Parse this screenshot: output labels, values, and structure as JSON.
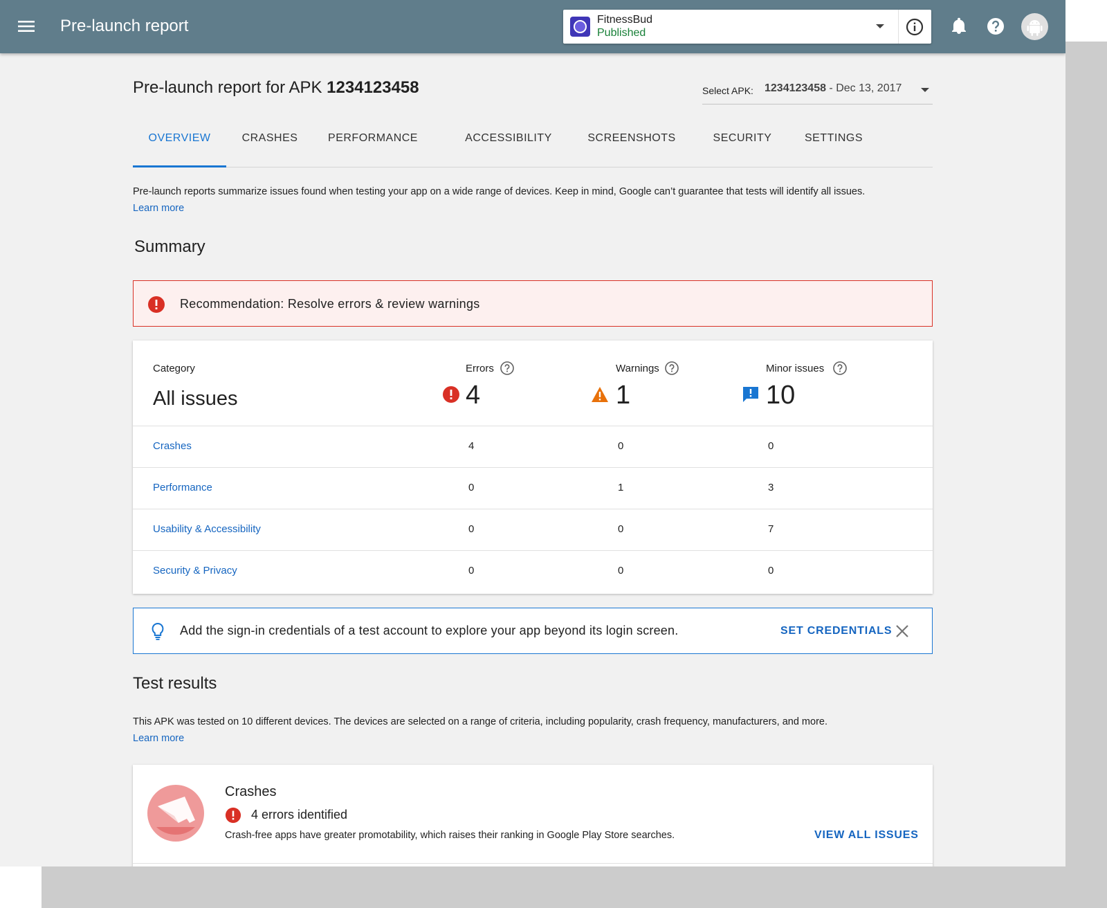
{
  "appbar": {
    "title": "Pre-launch report",
    "app_name": "FitnessBud",
    "app_status": "Published",
    "icons": [
      "menu-icon",
      "chevron-down-icon",
      "info-icon",
      "bell-icon",
      "help-icon",
      "android-avatar-icon"
    ]
  },
  "page": {
    "title_prefix": "Pre-launch report for APK ",
    "title_apk": "1234123458",
    "apk_select_label": "Select APK:",
    "apk_select_number": "1234123458",
    "apk_select_date": " - Dec 13, 2017"
  },
  "tabs": [
    {
      "label": "OVERVIEW",
      "active": true
    },
    {
      "label": "CRASHES"
    },
    {
      "label": "PERFORMANCE"
    },
    {
      "label": "ACCESSIBILITY"
    },
    {
      "label": "SCREENSHOTS"
    },
    {
      "label": "SECURITY"
    },
    {
      "label": "SETTINGS"
    }
  ],
  "intro": {
    "text": "Pre-launch reports summarize issues found when testing your app on a wide range of devices. Keep in mind, Google can’t guarantee that tests will identify all issues.",
    "learn_more": "Learn more"
  },
  "summary": {
    "title": "Summary",
    "recommendation": "Recommendation: Resolve errors & review warnings",
    "header": {
      "category_label": "Category",
      "category_value": "All issues",
      "errors_label": "Errors",
      "errors_value": "4",
      "warnings_label": "Warnings",
      "warnings_value": "1",
      "minor_label": "Minor issues",
      "minor_value": "10"
    },
    "rows": [
      {
        "category": "Crashes",
        "errors": "4",
        "warnings": "0",
        "minor": "0"
      },
      {
        "category": "Performance",
        "errors": "0",
        "warnings": "1",
        "minor": "3"
      },
      {
        "category": "Usability & Accessibility",
        "errors": "0",
        "warnings": "0",
        "minor": "7"
      },
      {
        "category": "Security & Privacy",
        "errors": "0",
        "warnings": "0",
        "minor": "0"
      }
    ]
  },
  "credentials": {
    "text": "Add the sign-in credentials of a test account to explore your app beyond its login screen.",
    "button": "SET CREDENTIALS"
  },
  "test_results": {
    "title": "Test results",
    "text": "This APK was tested on 10 different devices. The devices are selected on a range of criteria, including popularity, crash frequency, manufacturers, and more.",
    "learn_more": "Learn more",
    "crashes_card": {
      "title": "Crashes",
      "errors": "4 errors identified",
      "description": "Crash-free apps have greater promotability, which raises their ranking in Google Play Store searches.",
      "button": "VIEW ALL ISSUES"
    }
  },
  "colors": {
    "appbar": "#607d8b",
    "accent": "#1976d2",
    "error": "#d93025",
    "warning": "#e8710a",
    "minor": "#1976d2",
    "published": "#188038"
  }
}
